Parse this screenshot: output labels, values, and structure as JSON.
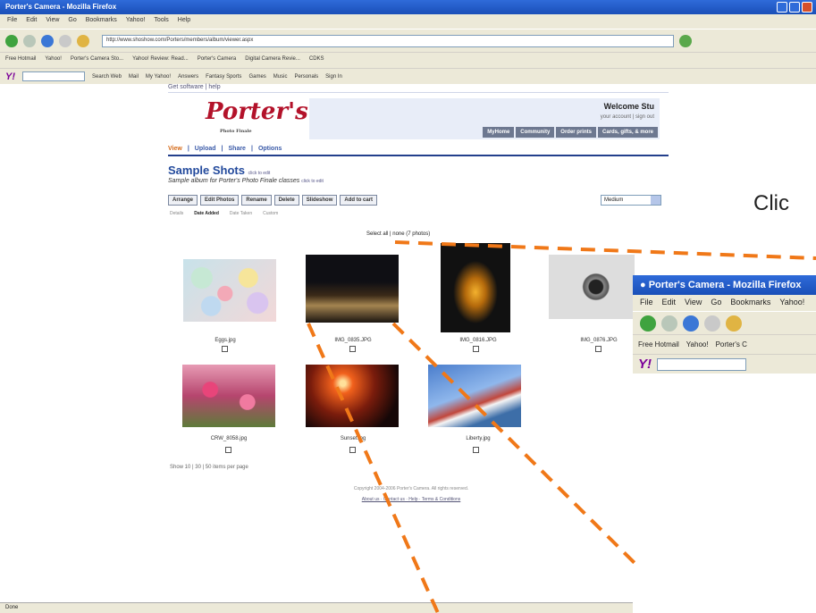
{
  "browser": {
    "title": "Porter's Camera - Mozilla Firefox",
    "menu": [
      "File",
      "Edit",
      "View",
      "Go",
      "Bookmarks",
      "Yahoo!",
      "Tools",
      "Help"
    ],
    "url": "http://www.shoshow.com/Porters/members/album/viewer.aspx",
    "bookmarks": [
      "Free Hotmail",
      "Yahoo!",
      "Porter's Camera Sto...",
      "Yahoo! Review: Read...",
      "Porter's Camera",
      "Digital Camera Revie...",
      "CDKS"
    ],
    "yahoo_items": [
      "Search Web",
      "Mail",
      "My Yahoo!",
      "Answers",
      "Fantasy Sports",
      "Games",
      "Music",
      "Personals",
      "Sign In"
    ],
    "status": "Done"
  },
  "site": {
    "top_links": "Get software | help",
    "logo": "Porter's",
    "logo_tagline": "Photo Finale",
    "welcome": "Welcome Stu",
    "account_links": "your account | sign out",
    "header_tabs": [
      "MyHome",
      "Community",
      "Order prints",
      "Cards, gifts, & more"
    ],
    "subnav": [
      "View",
      "Upload",
      "Share",
      "Options"
    ]
  },
  "album": {
    "title": "Sample Shots",
    "title_edit": "click to edit",
    "description": "Sample album for Porter's Photo Finale classes",
    "description_edit": "click to edit",
    "buttons": [
      "Arrange",
      "Edit Photos",
      "Rename",
      "Delete",
      "Slideshow",
      "Add to cart"
    ],
    "sort_select": "Medium",
    "view_options": [
      "Details",
      "Date Added",
      "Date Taken",
      "Custom"
    ],
    "select_all": "Select all | none (7 photos)",
    "photos": [
      {
        "name": "Eggs.jpg"
      },
      {
        "name": "IMG_0835.JPG"
      },
      {
        "name": "IMG_0816.JPG"
      },
      {
        "name": "IMG_0876.JPG"
      },
      {
        "name": "CRW_8058.jpg"
      },
      {
        "name": "Sunset.jpg"
      },
      {
        "name": "Liberty.jpg"
      }
    ],
    "pager": "Show 10 | 30 | 50 items per page",
    "copyright": "Copyright 2004-2006 Porter's Camera. All rights reserved.",
    "footer_links": "About us · Contact us · Help · Terms & Conditions"
  },
  "overlay": {
    "callout_text": "Clic",
    "zoom_title": "Porter's Camera - Mozilla Firefox",
    "zoom_menu": [
      "File",
      "Edit",
      "View",
      "Go",
      "Bookmarks",
      "Yahoo!"
    ],
    "zoom_bookmarks": [
      "Free Hotmail",
      "Yahoo!",
      "Porter's C"
    ]
  },
  "colors": {
    "accent_orange": "#f07818",
    "title_blue": "#1a4fb8",
    "brand_red": "#b3122a"
  }
}
